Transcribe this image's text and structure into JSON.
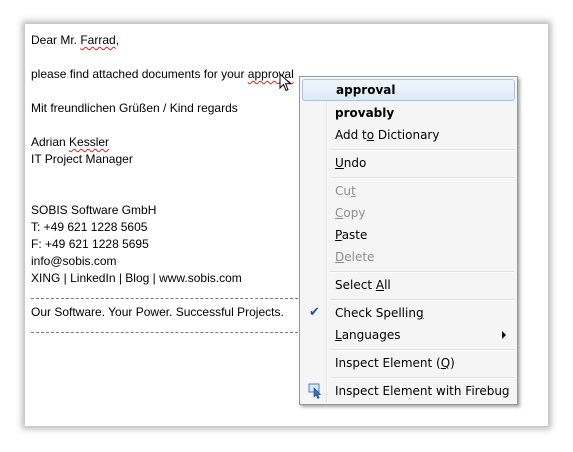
{
  "email": {
    "greeting": "Dear Mr. ",
    "greeting_name": "Farrad",
    "greeting_end": ",",
    "body_text": "please find attached documents for your ",
    "misspelled_word": "approval",
    "closing": "Mit freundlichen Grüßen / Kind regards",
    "signature_name_first": "Adrian ",
    "signature_name_last": "Kessler",
    "signature_title": "IT Project Manager",
    "company": "SOBIS Software GmbH",
    "phone": "T: +49 621 1228 5605",
    "fax": "F: +49 621 1228 5695",
    "email_address": "info@sobis.com",
    "links": "XING | LinkedIn | Blog | www.sobis.com",
    "slogan": "Our Software. Your Power. Successful Projects."
  },
  "context_menu": {
    "suggestions": [
      "approval",
      "provably"
    ],
    "add_to_dictionary": {
      "pre": "Add t",
      "key": "o",
      "post": " Dictionary"
    },
    "undo": {
      "pre": "",
      "key": "U",
      "post": "ndo"
    },
    "cut": {
      "pre": "Cu",
      "key": "t",
      "post": ""
    },
    "copy": {
      "pre": "",
      "key": "C",
      "post": "opy"
    },
    "paste": {
      "pre": "",
      "key": "P",
      "post": "aste"
    },
    "delete": {
      "pre": "",
      "key": "D",
      "post": "elete"
    },
    "select_all": {
      "pre": "Select ",
      "key": "A",
      "post": "ll"
    },
    "check_spelling": {
      "pre": "Check Spellin",
      "key": "g",
      "post": ""
    },
    "languages": {
      "pre": "",
      "key": "L",
      "post": "anguages"
    },
    "inspect_element": {
      "pre": "Inspect Element (",
      "key": "Q",
      "post": ")"
    },
    "inspect_firebug": "Inspect Element with Firebug",
    "check_spelling_checked": true
  },
  "colors": {
    "highlight_border": "#a8c4e6",
    "spell_underline": "#e02020",
    "menu_background": "#f5f5f5"
  }
}
